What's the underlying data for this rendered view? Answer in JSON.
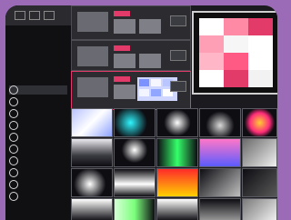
{
  "app": {
    "name": "",
    "accent": "#e23b6a",
    "background": "#1b1b1f"
  },
  "left_panel": {
    "items": [
      {
        "label": ""
      },
      {
        "label": ""
      },
      {
        "label": ""
      },
      {
        "label": ""
      },
      {
        "label": ""
      },
      {
        "label": ""
      },
      {
        "label": ""
      },
      {
        "label": ""
      },
      {
        "label": ""
      },
      {
        "label": ""
      }
    ]
  },
  "layers": [
    {
      "label": ""
    },
    {
      "label": ""
    },
    {
      "label": ""
    },
    {
      "label": ""
    }
  ],
  "output": {
    "grid_colors": [
      [
        "#ffffff",
        "#ff8aa6",
        "#e23b6a"
      ],
      [
        "#ff9fb5",
        "#f6f6f6",
        "#ffffff"
      ],
      [
        "#ffb6c6",
        "#ff5a84",
        "#ffffff"
      ],
      [
        "#ffffff",
        "#e23b6a",
        "#f2f2f2"
      ]
    ]
  },
  "clips": [
    {
      "label": ""
    },
    {
      "label": ""
    },
    {
      "label": ""
    },
    {
      "label": ""
    },
    {
      "label": ""
    },
    {
      "label": ""
    },
    {
      "label": ""
    },
    {
      "label": ""
    },
    {
      "label": ""
    },
    {
      "label": ""
    },
    {
      "label": ""
    },
    {
      "label": ""
    },
    {
      "label": ""
    },
    {
      "label": ""
    },
    {
      "label": ""
    },
    {
      "label": ""
    },
    {
      "label": ""
    },
    {
      "label": ""
    },
    {
      "label": ""
    },
    {
      "label": ""
    }
  ]
}
